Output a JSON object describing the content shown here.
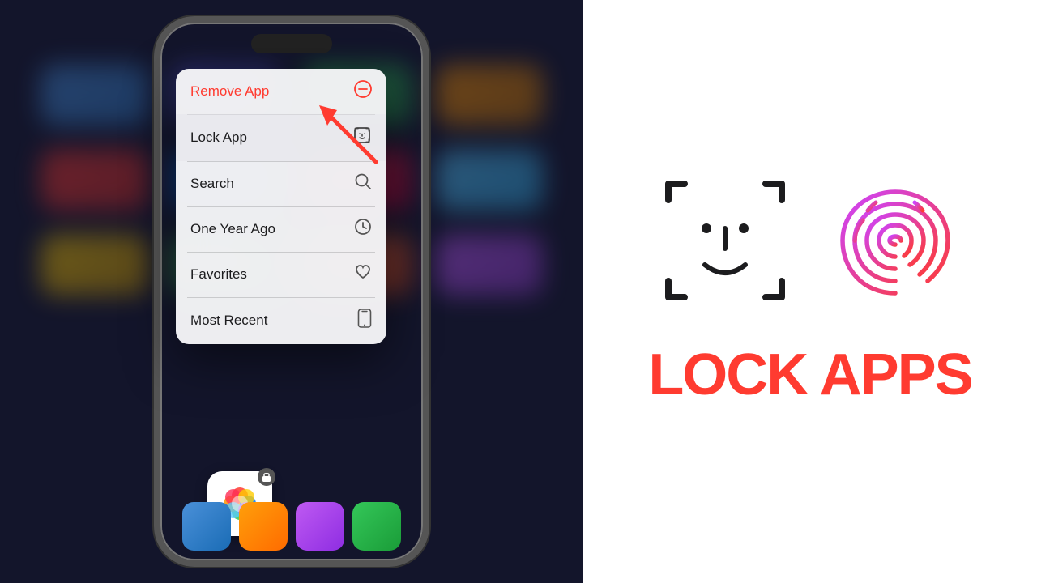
{
  "left": {
    "context_menu": {
      "items": [
        {
          "id": "remove-app",
          "label": "Remove App",
          "icon": "minus-circle",
          "icon_char": "⊖",
          "red": true
        },
        {
          "id": "lock-app",
          "label": "Lock App",
          "icon": "face-id",
          "red": false
        },
        {
          "id": "search",
          "label": "Search",
          "icon": "magnify",
          "icon_char": "⌕",
          "red": false
        },
        {
          "id": "one-year-ago",
          "label": "One Year Ago",
          "icon": "clock",
          "icon_char": "🕐",
          "red": false
        },
        {
          "id": "favorites",
          "label": "Favorites",
          "icon": "heart",
          "icon_char": "♡",
          "red": false
        },
        {
          "id": "most-recent",
          "label": "Most Recent",
          "icon": "phone",
          "icon_char": "📱",
          "red": false
        }
      ]
    }
  },
  "right": {
    "lock_apps_label": "LOCK APPS",
    "colors": {
      "red": "#ff3b30",
      "face_id_color": "#1c1c1e",
      "fingerprint_gradient_start": "#cc44ff",
      "fingerprint_gradient_end": "#ff3b30"
    }
  }
}
